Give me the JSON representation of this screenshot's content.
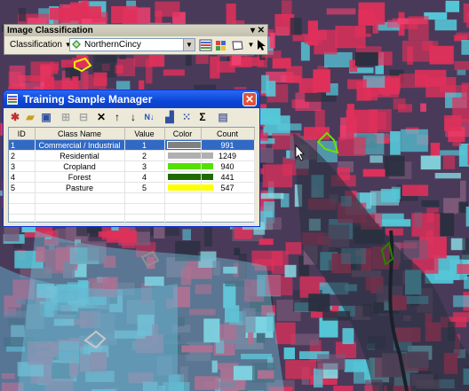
{
  "image_classification": {
    "title": "Image Classification",
    "classification_menu": "Classification",
    "layer_name": "NorthernCincy"
  },
  "tsm": {
    "title": "Training Sample Manager",
    "close_label": "✕",
    "columns": [
      "ID",
      "Class Name",
      "Value",
      "Color",
      "Count"
    ],
    "rows": [
      {
        "id": "1",
        "name": "Commercial / Industrial",
        "value": "1",
        "color": "#808080",
        "count": "991"
      },
      {
        "id": "2",
        "name": "Residential",
        "value": "2",
        "color": "#b0b0b0",
        "count": "1249"
      },
      {
        "id": "3",
        "name": "Cropland",
        "value": "3",
        "color": "#55e000",
        "count": "940"
      },
      {
        "id": "4",
        "name": "Forest",
        "value": "4",
        "color": "#1e6b00",
        "count": "441"
      },
      {
        "id": "5",
        "name": "Pasture",
        "value": "5",
        "color": "#ffff00",
        "count": "547"
      }
    ],
    "selected_row": 1
  },
  "colors": {
    "vegetation": "#e0305a",
    "urban": "#55c8d8",
    "dark_ground": "#2a3040"
  }
}
